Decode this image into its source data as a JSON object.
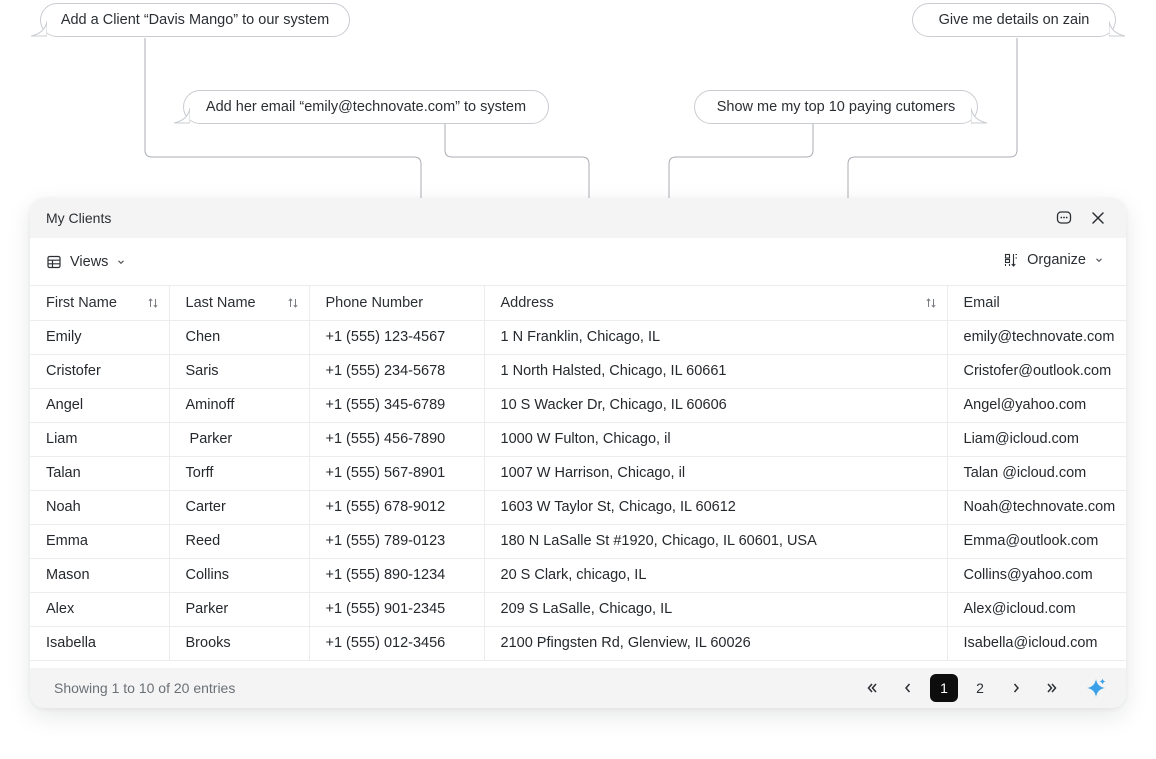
{
  "prompts": [
    {
      "id": "add-client",
      "text": "Add a Client “Davis Mango” to our system"
    },
    {
      "id": "details-zain",
      "text": "Give me details on zain"
    },
    {
      "id": "add-email",
      "text": "Add her email “emily@technovate.com” to system"
    },
    {
      "id": "top-customers",
      "text": "Show me my top 10 paying cutomers"
    }
  ],
  "window": {
    "title": "My Clients",
    "actions": {
      "more": "chat-bubble-icon",
      "close": "close-icon"
    }
  },
  "toolbar": {
    "views_label": "Views",
    "organize_label": "Organize"
  },
  "table": {
    "columns": [
      "First Name",
      "Last Name",
      "Phone Number",
      "Address",
      "Email"
    ],
    "rows": [
      [
        "Emily",
        "Chen",
        "+1 (555) 123-4567",
        "1 N Franklin, Chicago, IL",
        "emily@technovate.com"
      ],
      [
        "Cristofer",
        "Saris",
        "+1 (555) 234-5678",
        "1 North Halsted, Chicago, IL 60661",
        "Cristofer@outlook.com"
      ],
      [
        "Angel",
        "Aminoff",
        "+1 (555) 345-6789",
        "10 S Wacker Dr, Chicago, IL 60606",
        "Angel@yahoo.com"
      ],
      [
        "Liam",
        " Parker",
        "+1 (555) 456-7890",
        "1000 W Fulton, Chicago, il",
        "Liam@icloud.com"
      ],
      [
        "Talan",
        "Torff",
        "+1 (555) 567-8901",
        "1007 W Harrison, Chicago, il",
        "Talan @icloud.com"
      ],
      [
        "Noah",
        "Carter",
        "+1 (555) 678-9012",
        "1603 W Taylor St, Chicago, IL 60612",
        "Noah@technovate.com"
      ],
      [
        "Emma",
        "Reed",
        "+1 (555) 789-0123",
        "180 N LaSalle St #1920, Chicago, IL 60601, USA",
        "Emma@outlook.com"
      ],
      [
        "Mason",
        "Collins",
        "+1 (555) 890-1234",
        "20 S Clark, chicago, IL",
        "Collins@yahoo.com"
      ],
      [
        "Alex",
        "Parker",
        "+1 (555) 901-2345",
        "209 S LaSalle, Chicago, IL",
        "Alex@icloud.com"
      ],
      [
        "Isabella",
        "Brooks",
        "+1 (555) 012-3456",
        "2100 Pfingsten Rd, Glenview, IL 60026",
        "Isabella@icloud.com"
      ]
    ]
  },
  "footer": {
    "summary": "Showing 1 to 10 of 20 entries",
    "pages": [
      "1",
      "2"
    ],
    "current_page": "1"
  },
  "colors": {
    "accent": "#3aa0e8",
    "active_page_bg": "#0d0d0d"
  }
}
